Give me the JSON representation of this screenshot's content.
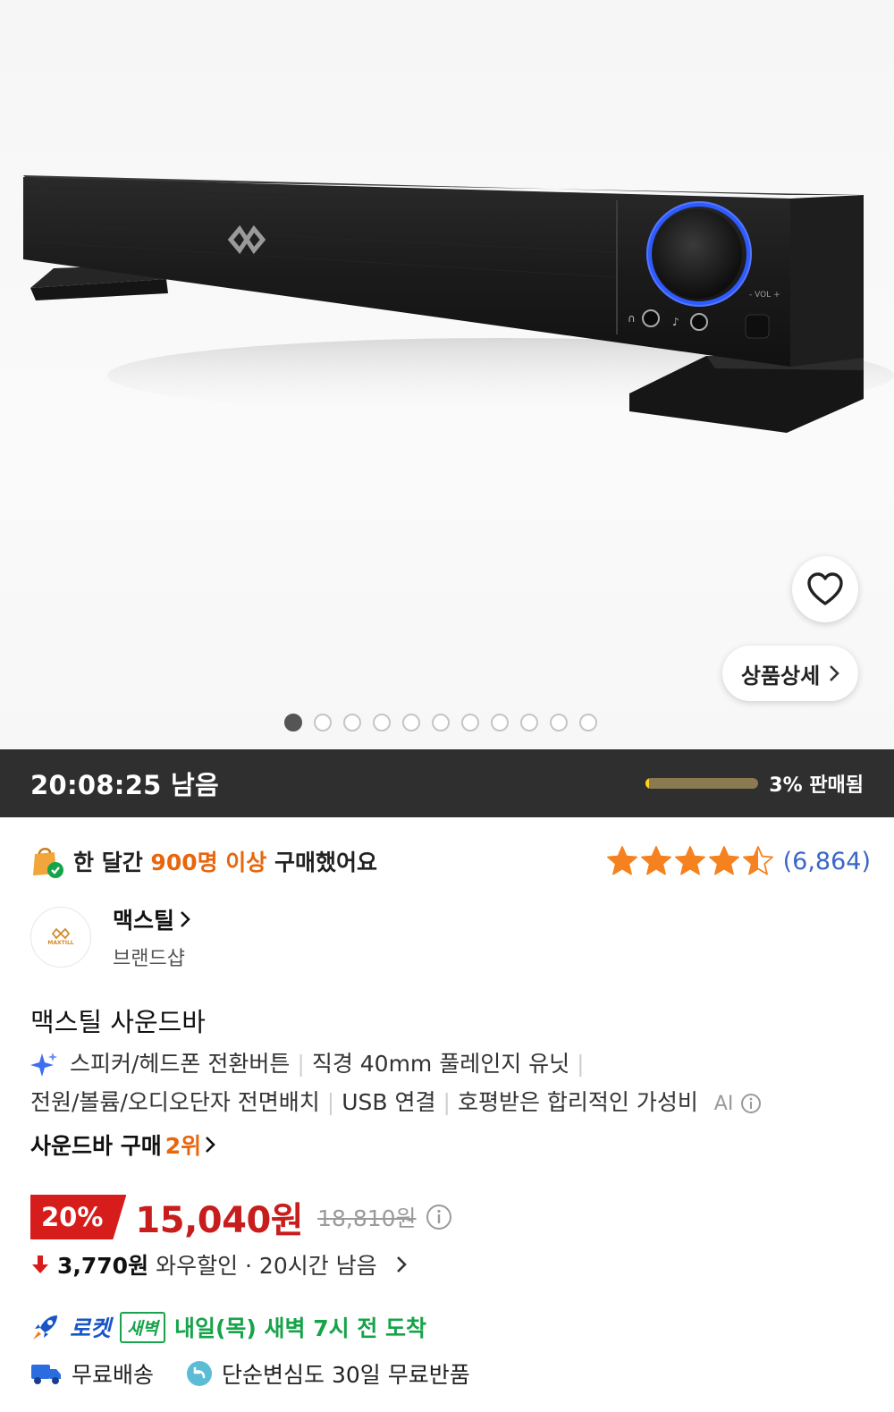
{
  "product_image": {
    "wishlist_icon": "heart-outline-icon",
    "detail_button_label": "상품상세",
    "carousel_total": 11,
    "carousel_active_index": 0
  },
  "deal_bar": {
    "time_remaining": "20:08:25 남음",
    "sold_percent": 3,
    "sold_label": "3% 판매됨"
  },
  "social_proof": {
    "prefix": "한 달간 ",
    "highlight": "900명 이상",
    "suffix": " 구매했어요"
  },
  "rating": {
    "stars": 4.5,
    "review_count": "(6,864)"
  },
  "brand": {
    "name": "맥스틸",
    "subtitle": "브랜드샵",
    "logo_text": "MAXTILL"
  },
  "product": {
    "title": "맥스틸 사운드바",
    "features": [
      "스피커/헤드폰 전환버튼",
      "직경 40mm 풀레인지 유닛",
      "전원/볼륨/오디오단자 전면배치",
      "USB 연결",
      "호평받은 합리적인 가성비"
    ],
    "ai_label": "AI"
  },
  "ranking": {
    "prefix": "사운드바 구매 ",
    "rank": "2위"
  },
  "price": {
    "discount": "20%",
    "sale_price": "15,040원",
    "original_price": "18,810원"
  },
  "wow_discount": {
    "amount": "3,770원",
    "label": "와우할인 · 20시간 남음"
  },
  "delivery": {
    "rocket_label": "로켓",
    "dawn_badge": "새벽",
    "arrival": "내일(목) 새벽 7시 전 도착",
    "free_shipping": "무료배송",
    "free_return": "단순변심도 30일 무료반품"
  },
  "colors": {
    "accent_orange": "#e8660c",
    "price_red": "#c81d1d",
    "rocket_blue": "#1a55c8",
    "arrival_green": "#17a34a",
    "bar_bg": "#2f2f2f",
    "sold_fill": "#ffd21f"
  }
}
